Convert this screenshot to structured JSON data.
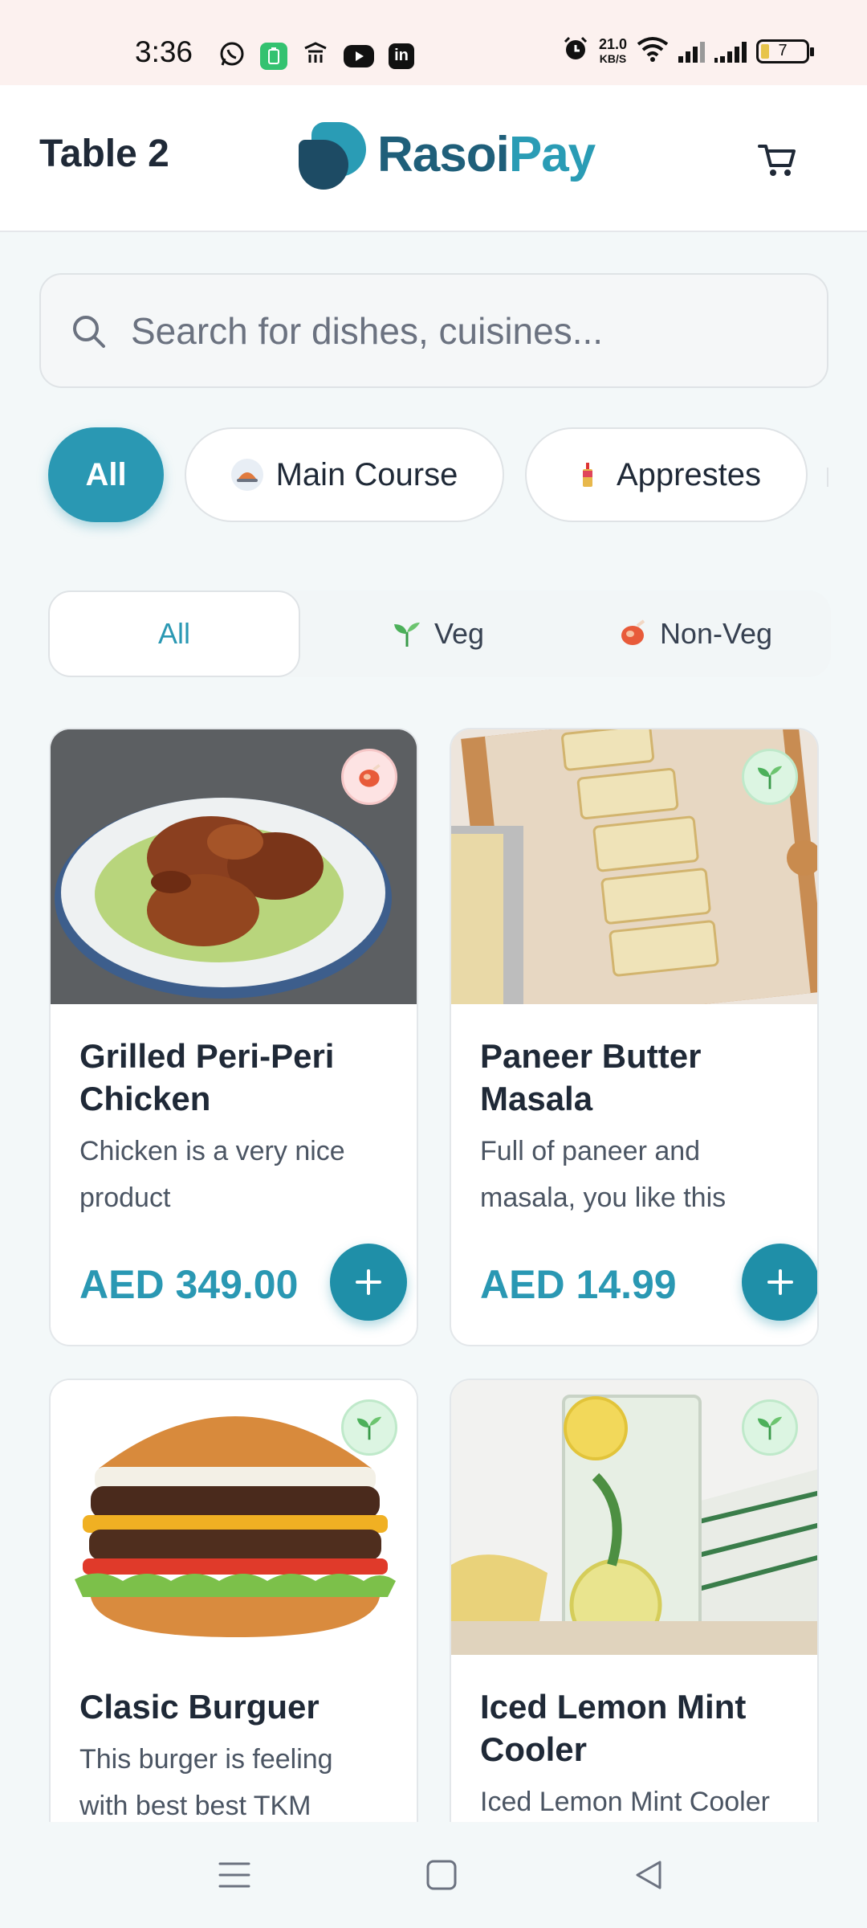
{
  "status_bar": {
    "time": "3:36",
    "net_speed_value": "21.0",
    "net_speed_unit": "KB/S",
    "battery": "7",
    "icons": [
      "whatsapp-icon",
      "battery-saver-icon",
      "notification-icon",
      "youtube-icon",
      "linkedin-icon",
      "alarm-icon",
      "wifi-icon",
      "signal-icon"
    ]
  },
  "header": {
    "table_label": "Table 2",
    "brand_part1": "Rasoi",
    "brand_part2": "Pay",
    "cart_icon": "cart-icon"
  },
  "search": {
    "placeholder": "Search for dishes, cuisines..."
  },
  "categories": [
    {
      "label": "All",
      "active": true
    },
    {
      "label": "Main Course",
      "icon": "food-platter-icon"
    },
    {
      "label": "Apprestes",
      "icon": "drink-icon"
    }
  ],
  "diet_filter": [
    {
      "label": "All",
      "active": true
    },
    {
      "label": "Veg",
      "icon": "sprout-icon"
    },
    {
      "label": "Non-Veg",
      "icon": "meat-icon"
    }
  ],
  "dishes": [
    {
      "name": "Grilled Peri-Peri Chicken",
      "description": "Chicken is a very nice product",
      "price": "AED 349.00",
      "diet": "nonveg"
    },
    {
      "name": "Paneer Butter Masala",
      "description": "Full of paneer and masala, you like this",
      "price": "AED 14.99",
      "diet": "veg"
    },
    {
      "name": "Clasic Burguer",
      "description": "This burger is feeling with best best TKM",
      "diet": "veg"
    },
    {
      "name": "Iced Lemon Mint Cooler",
      "description": "Iced Lemon Mint Cooler",
      "diet": "veg"
    }
  ],
  "colors": {
    "primary": "#2a98b3",
    "brand_dark": "#1d4b64",
    "veg_badge": "#dcf5e2",
    "nonveg_badge": "#fde3e3"
  }
}
